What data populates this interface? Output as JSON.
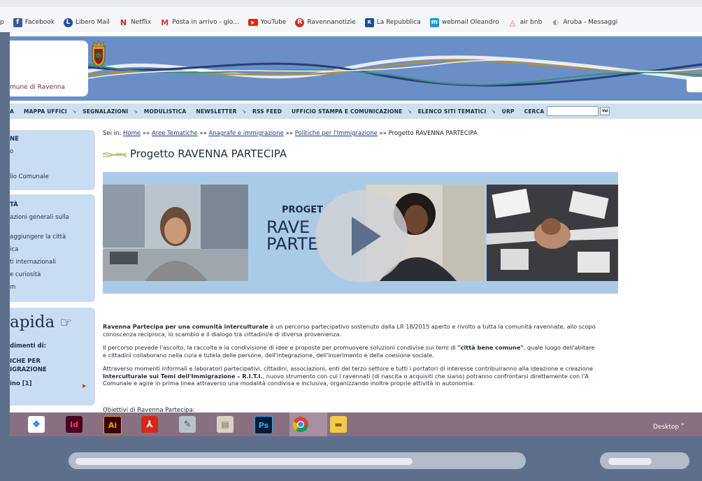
{
  "bookmarks": [
    {
      "label": "p",
      "icon": "none"
    },
    {
      "label": "Facebook",
      "icon": "facebook-icon"
    },
    {
      "label": "Libero Mail",
      "icon": "libero-icon"
    },
    {
      "label": "Netflix",
      "icon": "netflix-icon"
    },
    {
      "label": "Posta in arrivo - gio...",
      "icon": "gmail-icon"
    },
    {
      "label": "YouTube",
      "icon": "youtube-icon"
    },
    {
      "label": "Ravennanotizie",
      "icon": "ravennanotizie-icon"
    },
    {
      "label": "La Repubblica",
      "icon": "repubblica-icon"
    },
    {
      "label": "webmail Oleandro",
      "icon": "webmail-icon"
    },
    {
      "label": "air bnb",
      "icon": "airbnb-icon"
    },
    {
      "label": "Aruba - Messaggi",
      "icon": "aruba-icon"
    }
  ],
  "logo": {
    "text": "mune di Ravenna"
  },
  "nav": {
    "items": [
      "A",
      "MAPPA UFFICI",
      "SEGNALAZIONI",
      "MODULISTICA",
      "NEWSLETTER",
      "RSS FEED",
      "UFFICIO STAMPA E COMUNICAZIONE",
      "ELENCO SITI TEMATICI",
      "URP",
      "CERCA"
    ],
    "search_button": "Vai"
  },
  "sidebar": {
    "box1": [
      "NE",
      "o",
      "",
      "lio Comunale"
    ],
    "box2": [
      "TÀ",
      "azioni generali sulla",
      "",
      "aggiungere la città",
      "ica",
      "ti internazionali",
      "e curiosità",
      "m"
    ],
    "rapida_title": "apida",
    "rapida_lines": [
      "dimenti di:",
      "ICHE PER",
      "IGRAZIONE",
      "ino [1]"
    ]
  },
  "breadcrumb": {
    "prefix": "Sei in:",
    "links": [
      "Home",
      "Aree Tematiche",
      "Anagrafe e immigrazione",
      "Politiche per l'Immigrazione"
    ],
    "current": "Progetto RAVENNA PARTECIPA",
    "sep": "»»"
  },
  "page_title": "Progetto RAVENNA PARTECIPA",
  "banner": {
    "line1": "PROGET",
    "line2": "RAVE",
    "line3": "PARTE",
    "line3_tail": "PA"
  },
  "paragraphs": {
    "p1_bold": "Ravenna Partecipa per una comunità interculturale",
    "p1_rest": " è un percorso partecipativo sostenuto dalla LR 18/2015 aperto e rivolto a tutta la comunità ravennate, allo scopo",
    "p1_line2": "conoscenza reciproca, lo scambio e il dialogo tra cittadini/e di diversa provenienza.",
    "p2_start": "Il percorso prevede l'ascolto, la raccolta e la condivisione di idee e proposte per promuovere soluzioni condivise sui temi di ",
    "p2_bold": "\"città bene comune\"",
    "p2_rest": ", quale luogo dell'abitare",
    "p2_line2": "e cittadini collaborano nella cura e tutela delle persone, dell'integrazione, dell'inserimento e della coesione sociale.",
    "p3_line1": "Attraverso momenti informali e laboratori partecipativi, cittadini, associazioni, enti del terzo settore e tutti i portatori di interesse contribuiranno alla ideazione e creazione",
    "p3_bold": "Interculturale sui Temi dell'Immigrazione – R.I.T.I.",
    "p3_rest": ", nuovo strumento con cui i ravennati (di nascita o acquisiti che siano) potranno confrontarsi direttamente con l'A",
    "p3_line3": "Comunale e agire in prima linea attraverso una modalità condivisa e inclusiva, organizzando inoltre proprie attività in autonomia.",
    "objectives": "Obiettivi di Ravenna Partecipa:"
  },
  "taskbar": {
    "apps": [
      "dropbox-icon",
      "indesign-icon",
      "illustrator-icon",
      "acrobat-icon",
      "notes-icon",
      "documents-icon",
      "photoshop-icon",
      "chrome-icon",
      "folder-icon"
    ],
    "app_labels": {
      "indesign": "Id",
      "illustrator": "Ai",
      "photoshop": "Ps"
    },
    "desktop_label": "Desktop",
    "chevron": "»"
  },
  "video": {
    "progress": 0.76,
    "volume": 0.6
  },
  "colors": {
    "header": "#6a8fc6",
    "sidebar": "#c9ddf2",
    "taskbar": "#887081",
    "controls": "#5e6f8b"
  }
}
